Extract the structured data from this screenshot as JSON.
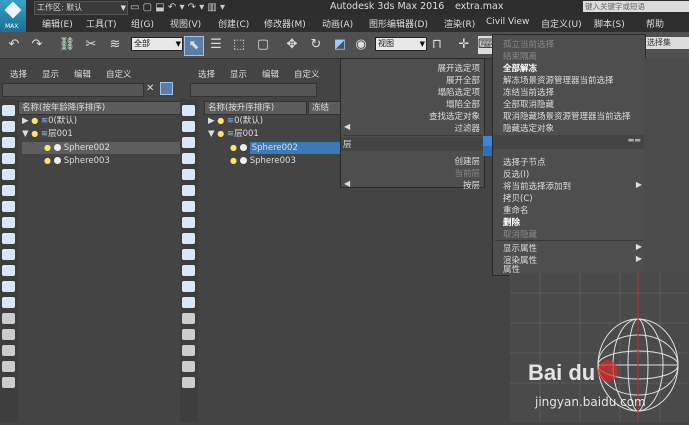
{
  "titlebar": {
    "workspace_label": "工作区: 默认",
    "app_title": "Autodesk 3ds Max 2016",
    "file_name": "extra.max",
    "search_placeholder": "键入关键字或短语"
  },
  "appbutton": {
    "label": "MAX"
  },
  "menubar": {
    "items": [
      "编辑(E)",
      "工具(T)",
      "组(G)",
      "视图(V)",
      "创建(C)",
      "修改器(M)",
      "动画(A)",
      "图形编辑器(D)",
      "渲染(R)",
      "Civil View",
      "自定义(U)",
      "脚本(S)",
      "帮助"
    ]
  },
  "toolbar": {
    "filter_select": "全部",
    "view_select": "视图",
    "selection_set_placeholder": "选择集"
  },
  "left_explorer": {
    "tabs": [
      "选择",
      "显示",
      "编辑",
      "自定义"
    ],
    "column_header": "名称(按年龄降序排序)",
    "rows": [
      {
        "label": "0(默认)",
        "type": "layer"
      },
      {
        "label": "层001",
        "type": "layer"
      },
      {
        "label": "Sphere002",
        "type": "object"
      },
      {
        "label": "Sphere003",
        "type": "object"
      }
    ]
  },
  "right_explorer": {
    "tabs": [
      "选择",
      "显示",
      "编辑",
      "自定义"
    ],
    "column_header": "名称(按升序排序)",
    "column_header2": "冻结",
    "rows": [
      {
        "label": "0(默认)",
        "type": "layer"
      },
      {
        "label": "层001",
        "type": "layer"
      },
      {
        "label": "Sphere002",
        "type": "object"
      },
      {
        "label": "Sphere003",
        "type": "object"
      }
    ]
  },
  "context_menu_left": {
    "items": [
      "展开选定项",
      "展开全部",
      "塌陷选定项",
      "塌陷全部",
      "查找选定对象",
      "过滤器",
      "层",
      "创建层",
      "当前层",
      "按层"
    ]
  },
  "context_menu_right": {
    "items": [
      "孤立当前选择",
      "结束隔离",
      "全部解冻",
      "解冻场景资源管理器当前选择",
      "冻结当前选择",
      "全部取消隐藏",
      "取消隐藏场景资源管理器当前选择",
      "隐藏选定对象",
      "选择子节点",
      "反选(I)",
      "将当前选择添加到",
      "拷贝(C)",
      "重命名",
      "删除",
      "取消隐藏",
      "显示属性",
      "渲染属性",
      "属性"
    ]
  },
  "watermark": {
    "brand": "Bai du",
    "url": "jingyan.baidu.com"
  }
}
